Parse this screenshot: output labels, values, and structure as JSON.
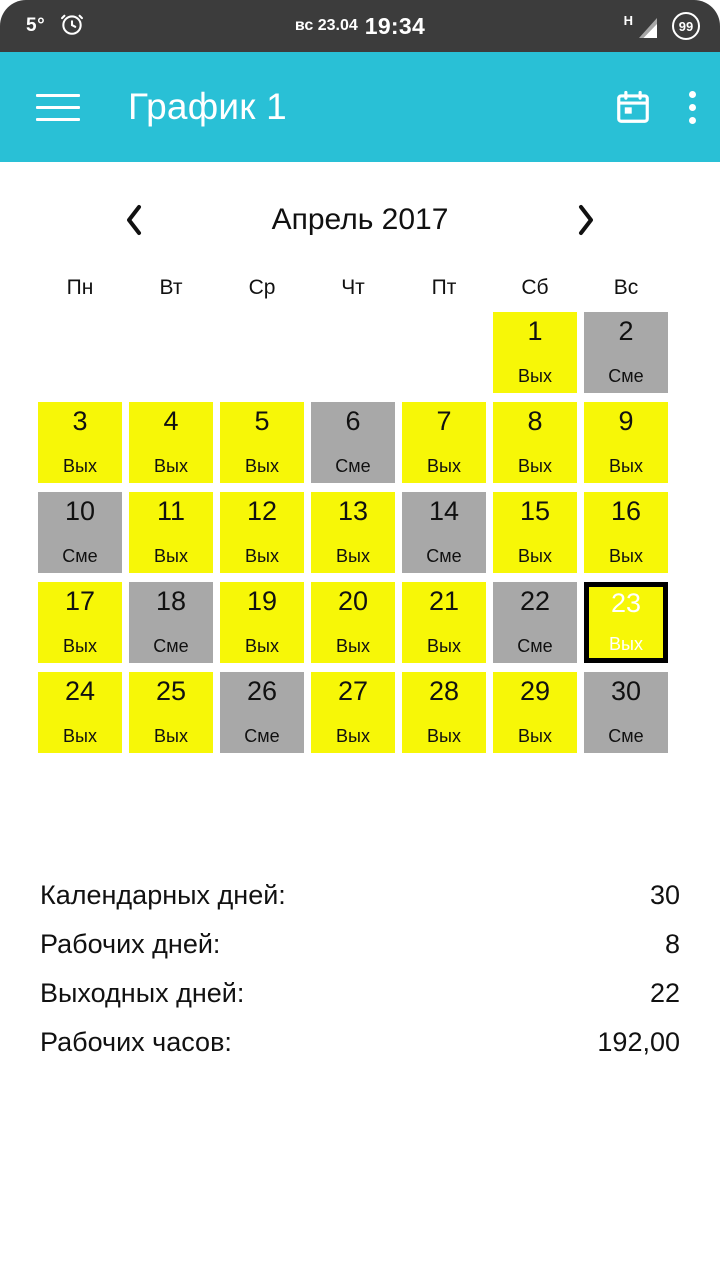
{
  "status_bar": {
    "temperature": "5°",
    "alarm_icon": "alarm-clock-icon",
    "date": "вс 23.04",
    "time": "19:34",
    "network_type": "H",
    "signal_icon": "signal-triangle-icon",
    "battery": "99"
  },
  "app_bar": {
    "menu_icon": "hamburger-menu-icon",
    "title": "График 1",
    "calendar_icon": "calendar-icon",
    "overflow_icon": "overflow-menu-icon",
    "background_color": "#29c0d6"
  },
  "month_nav": {
    "prev_label": "‹",
    "next_label": "›",
    "month": "Апрель 2017"
  },
  "weekdays": [
    "Пн",
    "Вт",
    "Ср",
    "Чт",
    "Пт",
    "Сб",
    "Вс"
  ],
  "legend": {
    "day_off": "Вых",
    "shift": "Сме",
    "day_off_color": "#f7f707",
    "shift_color": "#a8a8a8",
    "today_border_color": "#000000"
  },
  "calendar": {
    "leading_blanks": 5,
    "days": [
      {
        "num": "1",
        "label": "Вых",
        "type": "vyh",
        "today": false
      },
      {
        "num": "2",
        "label": "Сме",
        "type": "sme",
        "today": false
      },
      {
        "num": "3",
        "label": "Вых",
        "type": "vyh",
        "today": false
      },
      {
        "num": "4",
        "label": "Вых",
        "type": "vyh",
        "today": false
      },
      {
        "num": "5",
        "label": "Вых",
        "type": "vyh",
        "today": false
      },
      {
        "num": "6",
        "label": "Сме",
        "type": "sme",
        "today": false
      },
      {
        "num": "7",
        "label": "Вых",
        "type": "vyh",
        "today": false
      },
      {
        "num": "8",
        "label": "Вых",
        "type": "vyh",
        "today": false
      },
      {
        "num": "9",
        "label": "Вых",
        "type": "vyh",
        "today": false
      },
      {
        "num": "10",
        "label": "Сме",
        "type": "sme",
        "today": false
      },
      {
        "num": "11",
        "label": "Вых",
        "type": "vyh",
        "today": false
      },
      {
        "num": "12",
        "label": "Вых",
        "type": "vyh",
        "today": false
      },
      {
        "num": "13",
        "label": "Вых",
        "type": "vyh",
        "today": false
      },
      {
        "num": "14",
        "label": "Сме",
        "type": "sme",
        "today": false
      },
      {
        "num": "15",
        "label": "Вых",
        "type": "vyh",
        "today": false
      },
      {
        "num": "16",
        "label": "Вых",
        "type": "vyh",
        "today": false
      },
      {
        "num": "17",
        "label": "Вых",
        "type": "vyh",
        "today": false
      },
      {
        "num": "18",
        "label": "Сме",
        "type": "sme",
        "today": false
      },
      {
        "num": "19",
        "label": "Вых",
        "type": "vyh",
        "today": false
      },
      {
        "num": "20",
        "label": "Вых",
        "type": "vyh",
        "today": false
      },
      {
        "num": "21",
        "label": "Вых",
        "type": "vyh",
        "today": false
      },
      {
        "num": "22",
        "label": "Сме",
        "type": "sme",
        "today": false
      },
      {
        "num": "23",
        "label": "Вых",
        "type": "vyh",
        "today": true
      },
      {
        "num": "24",
        "label": "Вых",
        "type": "vyh",
        "today": false
      },
      {
        "num": "25",
        "label": "Вых",
        "type": "vyh",
        "today": false
      },
      {
        "num": "26",
        "label": "Сме",
        "type": "sme",
        "today": false
      },
      {
        "num": "27",
        "label": "Вых",
        "type": "vyh",
        "today": false
      },
      {
        "num": "28",
        "label": "Вых",
        "type": "vyh",
        "today": false
      },
      {
        "num": "29",
        "label": "Вых",
        "type": "vyh",
        "today": false
      },
      {
        "num": "30",
        "label": "Сме",
        "type": "sme",
        "today": false
      }
    ]
  },
  "summary": [
    {
      "key": "Календарных дней:",
      "value": "30"
    },
    {
      "key": "Рабочих дней:",
      "value": "8"
    },
    {
      "key": "Выходных дней:",
      "value": "22"
    },
    {
      "key": "Рабочих часов:",
      "value": "192,00"
    }
  ]
}
